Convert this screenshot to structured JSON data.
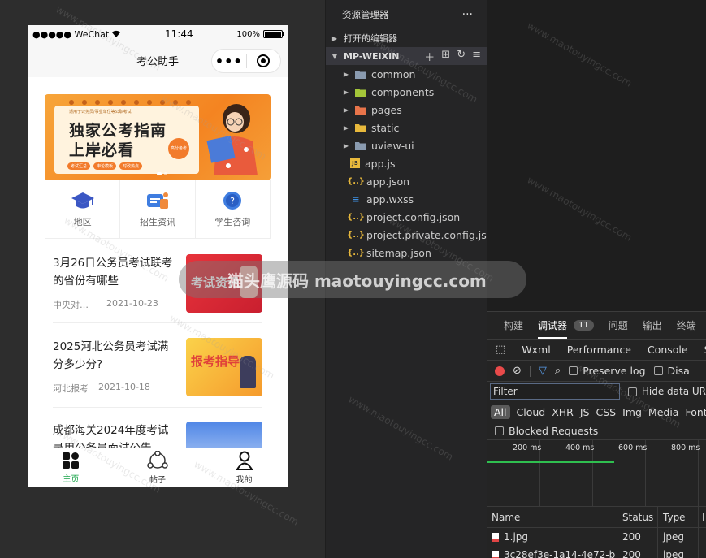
{
  "phone": {
    "status": {
      "carrier": "●●●●● WeChat",
      "time": "11:44",
      "battery": "100%"
    },
    "nav_title": "考公助手",
    "banner": {
      "subtitle": "适用于公务员/事业单位等公职考试",
      "title_line1": "独家公考指南",
      "title_line2": "上岸必看",
      "badge": "高分备考",
      "tags": [
        "考试汇总",
        "申论模板",
        "时政热点"
      ]
    },
    "grid": [
      {
        "label": "地区",
        "icon": "graduation-cap-icon"
      },
      {
        "label": "招生资讯",
        "icon": "news-icon"
      },
      {
        "label": "学生咨询",
        "icon": "chat-question-icon"
      }
    ],
    "news": [
      {
        "title": "3月26日公务员考试联考的省份有哪些",
        "source": "中央对外...",
        "date": "2021-10-23",
        "image_text": "考试资讯"
      },
      {
        "title": "2025河北公务员考试满分多少分?",
        "source": "河北报考",
        "date": "2021-10-18",
        "image_text": "报考指导"
      },
      {
        "title": "成都海关2024年度考试录用公务员面试公告",
        "source": "",
        "date": "",
        "image_text": ""
      }
    ],
    "tabbar": [
      {
        "label": "主页",
        "active": true
      },
      {
        "label": "帖子",
        "active": false
      },
      {
        "label": "我的",
        "active": false
      }
    ]
  },
  "explorer": {
    "title": "资源管理器",
    "more": "···",
    "open_editors": "打开的编辑器",
    "project": "MP-WEIXIN",
    "items": [
      {
        "name": "common",
        "kind": "folder",
        "color": "#8a9bb0"
      },
      {
        "name": "components",
        "kind": "folder",
        "color": "#a4c639"
      },
      {
        "name": "pages",
        "kind": "folder",
        "color": "#e8744a"
      },
      {
        "name": "static",
        "kind": "folder",
        "color": "#e8b93c"
      },
      {
        "name": "uview-ui",
        "kind": "folder",
        "color": "#8a9bb0"
      },
      {
        "name": "app.js",
        "kind": "js"
      },
      {
        "name": "app.json",
        "kind": "json"
      },
      {
        "name": "app.wxss",
        "kind": "wxss"
      },
      {
        "name": "project.config.json",
        "kind": "json"
      },
      {
        "name": "project.private.config.js...",
        "kind": "json"
      },
      {
        "name": "sitemap.json",
        "kind": "json"
      }
    ]
  },
  "devtools": {
    "top_tabs": [
      "构建",
      "调试器",
      "问题",
      "输出",
      "终端"
    ],
    "debugger_badge": "11",
    "panel_tabs": [
      "Wxml",
      "Performance",
      "Console",
      "S"
    ],
    "preserve_log": "Preserve log",
    "disable_cache": "Disa",
    "filter_placeholder": "Filter",
    "hide_data_urls": "Hide data UR",
    "types": [
      "All",
      "Cloud",
      "XHR",
      "JS",
      "CSS",
      "Img",
      "Media",
      "Font"
    ],
    "blocked_requests": "Blocked Requests",
    "timeline_labels": [
      "200 ms",
      "400 ms",
      "600 ms",
      "800 ms"
    ],
    "columns": [
      "Name",
      "Status",
      "Type",
      "I"
    ],
    "rows": [
      {
        "name": "1.jpg",
        "status": "200",
        "type": "jpeg"
      },
      {
        "name": "3c28ef3e-1a14-4e72-b",
        "status": "200",
        "type": "jpeg"
      }
    ]
  },
  "watermark": {
    "text": "猫头鹰源码 maotouyingcc.com",
    "diag": "www.maotouyingcc.com"
  }
}
